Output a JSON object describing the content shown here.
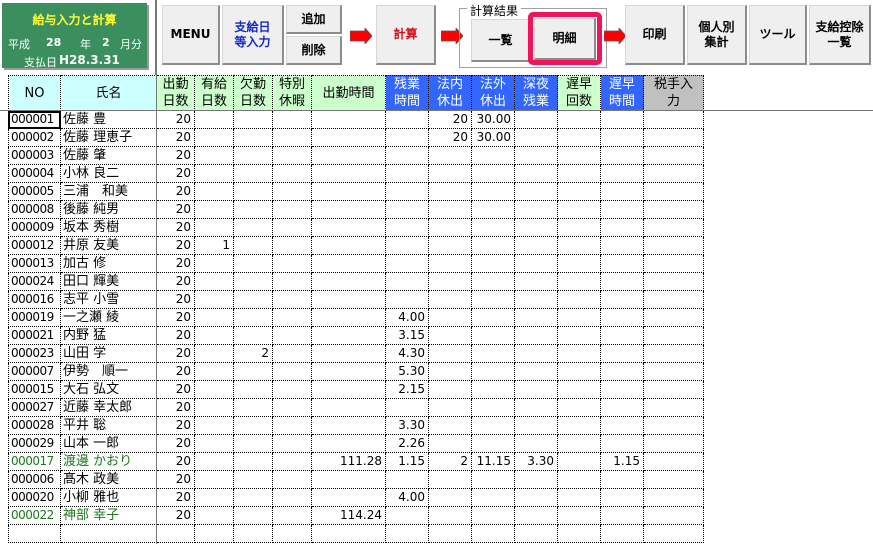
{
  "title_block": {
    "title": "給与入力と計算",
    "era": "平成",
    "year": "28",
    "year_unit": "年",
    "month": "2",
    "month_unit": "月分",
    "pay_date_label": "支払日",
    "pay_date": "H28.3.31"
  },
  "toolbar": {
    "menu": "MENU",
    "payday_input": "支給日\n等入力",
    "add": "追加",
    "delete": "削除",
    "calculate": "計算",
    "result_group_label": "計算結果",
    "list": "一覧",
    "detail": "明細",
    "print": "印刷",
    "individual_total": "個人別\n集計",
    "tools": "ツール",
    "deduction_list": "支給控除\n一覧"
  },
  "colors": {
    "title_bg": "#3b8f5e",
    "title_text": "#ffff33",
    "header_cyan": "#ccffff",
    "header_green": "#ccffcc",
    "header_blue": "#3366ff",
    "header_gray": "#c0c0c0",
    "highlight": "#f0145a",
    "arrow": "#ff0000",
    "green_row_text": "#1a7a1a"
  },
  "table": {
    "columns": [
      {
        "key": "no",
        "label": "NO"
      },
      {
        "key": "name",
        "label": "氏名"
      },
      {
        "key": "work_days",
        "label": "出勤\n日数"
      },
      {
        "key": "paid_leave_days",
        "label": "有給\n日数"
      },
      {
        "key": "absent_days",
        "label": "欠勤\n日数"
      },
      {
        "key": "special_leave",
        "label": "特別\n休暇"
      },
      {
        "key": "work_hours",
        "label": "出勤時間"
      },
      {
        "key": "overtime_hours",
        "label": "残業\n時間"
      },
      {
        "key": "legal_holiday_work",
        "label": "法内\n休出"
      },
      {
        "key": "nonlegal_holiday_work",
        "label": "法外\n休出"
      },
      {
        "key": "night_overtime",
        "label": "深夜\n残業"
      },
      {
        "key": "late_early_count",
        "label": "遅早\n回数"
      },
      {
        "key": "late_early_hours",
        "label": "遅早\n時間"
      },
      {
        "key": "tax_allowance_input",
        "label": "税手入\n力"
      }
    ],
    "rows": [
      {
        "no": "000001",
        "name": "佐藤 豊",
        "work_days": "20",
        "paid_leave_days": "",
        "absent_days": "",
        "special_leave": "",
        "work_hours": "",
        "overtime_hours": "",
        "legal_holiday_work": "20",
        "nonlegal_holiday_work": "30.00",
        "night_overtime": "",
        "late_early_count": "",
        "late_early_hours": "",
        "tax_allowance_input": "",
        "highlight": false,
        "selected": true
      },
      {
        "no": "000002",
        "name": "佐藤 理恵子",
        "work_days": "20",
        "paid_leave_days": "",
        "absent_days": "",
        "special_leave": "",
        "work_hours": "",
        "overtime_hours": "",
        "legal_holiday_work": "20",
        "nonlegal_holiday_work": "30.00",
        "night_overtime": "",
        "late_early_count": "",
        "late_early_hours": "",
        "tax_allowance_input": "",
        "highlight": false
      },
      {
        "no": "000003",
        "name": "佐藤 肇",
        "work_days": "20",
        "paid_leave_days": "",
        "absent_days": "",
        "special_leave": "",
        "work_hours": "",
        "overtime_hours": "",
        "legal_holiday_work": "",
        "nonlegal_holiday_work": "",
        "night_overtime": "",
        "late_early_count": "",
        "late_early_hours": "",
        "tax_allowance_input": "",
        "highlight": false
      },
      {
        "no": "000004",
        "name": "小林 良二",
        "work_days": "20",
        "paid_leave_days": "",
        "absent_days": "",
        "special_leave": "",
        "work_hours": "",
        "overtime_hours": "",
        "legal_holiday_work": "",
        "nonlegal_holiday_work": "",
        "night_overtime": "",
        "late_early_count": "",
        "late_early_hours": "",
        "tax_allowance_input": "",
        "highlight": false
      },
      {
        "no": "000005",
        "name": "三浦　和美",
        "work_days": "20",
        "paid_leave_days": "",
        "absent_days": "",
        "special_leave": "",
        "work_hours": "",
        "overtime_hours": "",
        "legal_holiday_work": "",
        "nonlegal_holiday_work": "",
        "night_overtime": "",
        "late_early_count": "",
        "late_early_hours": "",
        "tax_allowance_input": "",
        "highlight": false
      },
      {
        "no": "000008",
        "name": "後藤 純男",
        "work_days": "20",
        "paid_leave_days": "",
        "absent_days": "",
        "special_leave": "",
        "work_hours": "",
        "overtime_hours": "",
        "legal_holiday_work": "",
        "nonlegal_holiday_work": "",
        "night_overtime": "",
        "late_early_count": "",
        "late_early_hours": "",
        "tax_allowance_input": "",
        "highlight": false
      },
      {
        "no": "000009",
        "name": "坂本 秀樹",
        "work_days": "20",
        "paid_leave_days": "",
        "absent_days": "",
        "special_leave": "",
        "work_hours": "",
        "overtime_hours": "",
        "legal_holiday_work": "",
        "nonlegal_holiday_work": "",
        "night_overtime": "",
        "late_early_count": "",
        "late_early_hours": "",
        "tax_allowance_input": "",
        "highlight": false
      },
      {
        "no": "000012",
        "name": "井原 友美",
        "work_days": "20",
        "paid_leave_days": "1",
        "absent_days": "",
        "special_leave": "",
        "work_hours": "",
        "overtime_hours": "",
        "legal_holiday_work": "",
        "nonlegal_holiday_work": "",
        "night_overtime": "",
        "late_early_count": "",
        "late_early_hours": "",
        "tax_allowance_input": "",
        "highlight": false
      },
      {
        "no": "000013",
        "name": "加古 修",
        "work_days": "20",
        "paid_leave_days": "",
        "absent_days": "",
        "special_leave": "",
        "work_hours": "",
        "overtime_hours": "",
        "legal_holiday_work": "",
        "nonlegal_holiday_work": "",
        "night_overtime": "",
        "late_early_count": "",
        "late_early_hours": "",
        "tax_allowance_input": "",
        "highlight": false
      },
      {
        "no": "000024",
        "name": "田口 輝美",
        "work_days": "20",
        "paid_leave_days": "",
        "absent_days": "",
        "special_leave": "",
        "work_hours": "",
        "overtime_hours": "",
        "legal_holiday_work": "",
        "nonlegal_holiday_work": "",
        "night_overtime": "",
        "late_early_count": "",
        "late_early_hours": "",
        "tax_allowance_input": "",
        "highlight": false
      },
      {
        "no": "000016",
        "name": "志平 小雪",
        "work_days": "20",
        "paid_leave_days": "",
        "absent_days": "",
        "special_leave": "",
        "work_hours": "",
        "overtime_hours": "",
        "legal_holiday_work": "",
        "nonlegal_holiday_work": "",
        "night_overtime": "",
        "late_early_count": "",
        "late_early_hours": "",
        "tax_allowance_input": "",
        "highlight": false
      },
      {
        "no": "000019",
        "name": "一之瀬 綾",
        "work_days": "20",
        "paid_leave_days": "",
        "absent_days": "",
        "special_leave": "",
        "work_hours": "",
        "overtime_hours": "4.00",
        "legal_holiday_work": "",
        "nonlegal_holiday_work": "",
        "night_overtime": "",
        "late_early_count": "",
        "late_early_hours": "",
        "tax_allowance_input": "",
        "highlight": false
      },
      {
        "no": "000021",
        "name": "内野 猛",
        "work_days": "20",
        "paid_leave_days": "",
        "absent_days": "",
        "special_leave": "",
        "work_hours": "",
        "overtime_hours": "3.15",
        "legal_holiday_work": "",
        "nonlegal_holiday_work": "",
        "night_overtime": "",
        "late_early_count": "",
        "late_early_hours": "",
        "tax_allowance_input": "",
        "highlight": false
      },
      {
        "no": "000023",
        "name": "山田 学",
        "work_days": "20",
        "paid_leave_days": "",
        "absent_days": "2",
        "special_leave": "",
        "work_hours": "",
        "overtime_hours": "4.30",
        "legal_holiday_work": "",
        "nonlegal_holiday_work": "",
        "night_overtime": "",
        "late_early_count": "",
        "late_early_hours": "",
        "tax_allowance_input": "",
        "highlight": false
      },
      {
        "no": "000007",
        "name": "伊勢　順一",
        "work_days": "20",
        "paid_leave_days": "",
        "absent_days": "",
        "special_leave": "",
        "work_hours": "",
        "overtime_hours": "5.30",
        "legal_holiday_work": "",
        "nonlegal_holiday_work": "",
        "night_overtime": "",
        "late_early_count": "",
        "late_early_hours": "",
        "tax_allowance_input": "",
        "highlight": false
      },
      {
        "no": "000015",
        "name": "大石 弘文",
        "work_days": "20",
        "paid_leave_days": "",
        "absent_days": "",
        "special_leave": "",
        "work_hours": "",
        "overtime_hours": "2.15",
        "legal_holiday_work": "",
        "nonlegal_holiday_work": "",
        "night_overtime": "",
        "late_early_count": "",
        "late_early_hours": "",
        "tax_allowance_input": "",
        "highlight": false
      },
      {
        "no": "000027",
        "name": "近藤 幸太郎",
        "work_days": "20",
        "paid_leave_days": "",
        "absent_days": "",
        "special_leave": "",
        "work_hours": "",
        "overtime_hours": "",
        "legal_holiday_work": "",
        "nonlegal_holiday_work": "",
        "night_overtime": "",
        "late_early_count": "",
        "late_early_hours": "",
        "tax_allowance_input": "",
        "highlight": false
      },
      {
        "no": "000028",
        "name": "平井 聡",
        "work_days": "20",
        "paid_leave_days": "",
        "absent_days": "",
        "special_leave": "",
        "work_hours": "",
        "overtime_hours": "3.30",
        "legal_holiday_work": "",
        "nonlegal_holiday_work": "",
        "night_overtime": "",
        "late_early_count": "",
        "late_early_hours": "",
        "tax_allowance_input": "",
        "highlight": false
      },
      {
        "no": "000029",
        "name": "山本 一郎",
        "work_days": "20",
        "paid_leave_days": "",
        "absent_days": "",
        "special_leave": "",
        "work_hours": "",
        "overtime_hours": "2.26",
        "legal_holiday_work": "",
        "nonlegal_holiday_work": "",
        "night_overtime": "",
        "late_early_count": "",
        "late_early_hours": "",
        "tax_allowance_input": "",
        "highlight": false
      },
      {
        "no": "000017",
        "name": "渡邊 かおり",
        "work_days": "20",
        "paid_leave_days": "",
        "absent_days": "",
        "special_leave": "",
        "work_hours": "111.28",
        "overtime_hours": "1.15",
        "legal_holiday_work": "2",
        "nonlegal_holiday_work": "11.15",
        "night_overtime": "3.30",
        "late_early_count": "",
        "late_early_hours": "1.15",
        "tax_allowance_input": "",
        "highlight": true
      },
      {
        "no": "000006",
        "name": "髙木 政美",
        "work_days": "20",
        "paid_leave_days": "",
        "absent_days": "",
        "special_leave": "",
        "work_hours": "",
        "overtime_hours": "",
        "legal_holiday_work": "",
        "nonlegal_holiday_work": "",
        "night_overtime": "",
        "late_early_count": "",
        "late_early_hours": "",
        "tax_allowance_input": "",
        "highlight": false
      },
      {
        "no": "000020",
        "name": "小柳 雅也",
        "work_days": "20",
        "paid_leave_days": "",
        "absent_days": "",
        "special_leave": "",
        "work_hours": "",
        "overtime_hours": "4.00",
        "legal_holiday_work": "",
        "nonlegal_holiday_work": "",
        "night_overtime": "",
        "late_early_count": "",
        "late_early_hours": "",
        "tax_allowance_input": "",
        "highlight": false
      },
      {
        "no": "000022",
        "name": "神部 幸子",
        "work_days": "20",
        "paid_leave_days": "",
        "absent_days": "",
        "special_leave": "",
        "work_hours": "114.24",
        "overtime_hours": "",
        "legal_holiday_work": "",
        "nonlegal_holiday_work": "",
        "night_overtime": "",
        "late_early_count": "",
        "late_early_hours": "",
        "tax_allowance_input": "",
        "highlight": true
      }
    ]
  }
}
